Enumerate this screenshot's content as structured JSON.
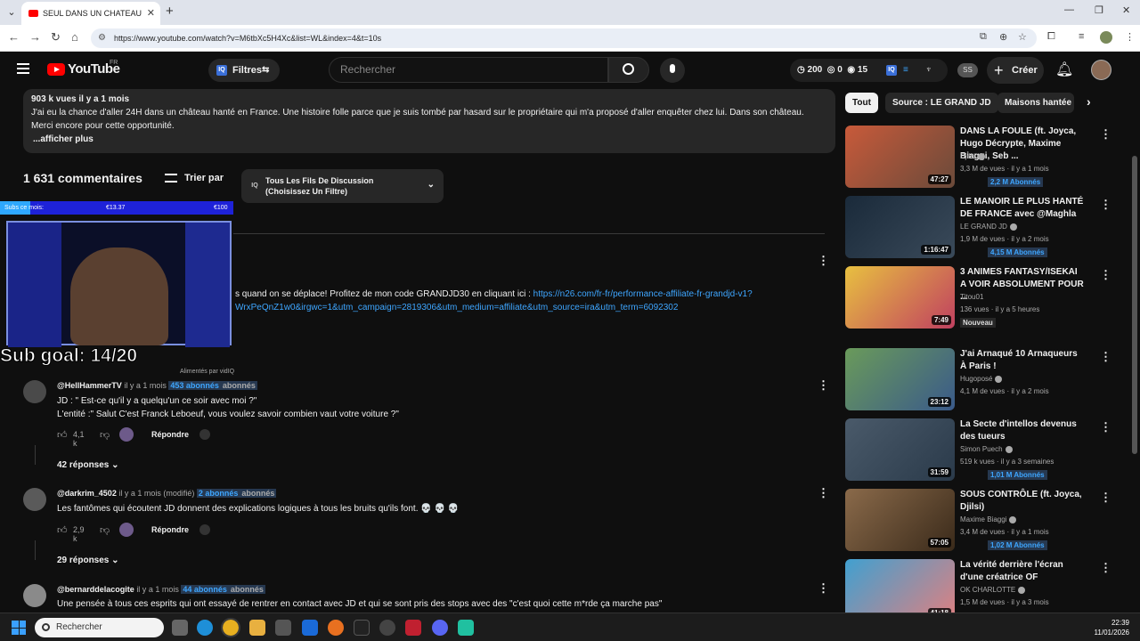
{
  "browser": {
    "tab_title": "SEUL DANS UN CHATEAU HANTÉ",
    "url": "https://www.youtube.com/watch?v=M6tbXc5H4Xc&list=WL&index=4&t=10s"
  },
  "youtube": {
    "logo_text": "YouTube",
    "region": "FR",
    "filters_label": "Filtres",
    "search_placeholder": "Rechercher",
    "stats": {
      "views": "200",
      "likes": "0",
      "watch": "15"
    },
    "ss_label": "SS",
    "create_label": "Créer"
  },
  "description": {
    "meta": "903 k vues  il y a 1 mois",
    "text": "J'ai eu la chance d'aller 24H dans un château hanté en France. Une histoire folle parce que je suis tombé par hasard sur le propriétaire qui m'a proposé d'aller enquêter chez lui. Dans son château. Merci encore pour cette opportunité.",
    "more": "...afficher plus"
  },
  "comments_header": {
    "count": "1 631 commentaires",
    "sort_label": "Trier par",
    "thread_filter": "Tous Les Fils De Discussion (Choisissez Un Filtre)"
  },
  "pinned": {
    "text": "s quand on se déplace! Profitez de mon code GRANDJD30 en cliquant ici : ",
    "link": "https://n26.com/fr-fr/performance-affiliate-fr-grandjd-v1?WrxPeQnZ1w0&irgwc=1&utm_campaign=2819306&utm_medium=affiliate&utm_source=ira&utm_term=6092302"
  },
  "stream_overlay": {
    "bar_label": "Subs ce mois:",
    "bar_mid": "€13.37",
    "bar_right": "€100",
    "sub_goal": "Sub goal: 14/20",
    "vidiq_credit": "Alimentés par vidIQ"
  },
  "comments": [
    {
      "author": "@HellHammerTV",
      "time": "il y a 1 mois",
      "subs": "453 abonnés",
      "subs_suffix": "abonnés",
      "lines": [
        "JD : \" Est-ce qu'il y a quelqu'un ce soir avec moi ?\"",
        "L'entité :\" Salut C'est Franck Leboeuf, vous voulez savoir combien vaut votre voiture ?\""
      ],
      "likes": "4,1 k",
      "reply_label": "Répondre",
      "replies": "42 réponses"
    },
    {
      "author": "@darkrim_4502",
      "time": "il y a 1 mois (modifié)",
      "subs": "2 abonnés",
      "subs_suffix": "abonnés",
      "lines": [
        "Les fantômes qui écoutent JD donnent des explications logiques à tous les bruits qu'ils font. 💀 💀 💀"
      ],
      "likes": "2,9 k",
      "reply_label": "Répondre",
      "replies": "29 réponses"
    },
    {
      "author": "@bernarddelacogite",
      "time": "il y a 1 mois",
      "subs": "44 abonnés",
      "subs_suffix": "abonnés",
      "lines": [
        "Une pensée à tous ces esprits qui ont essayé de rentrer en contact avec JD et qui se sont pris des stops avec des \"c'est quoi cette m*rde ça marche pas\""
      ]
    }
  ],
  "chips": [
    "Tout",
    "Source : LE GRAND JD",
    "Maisons hantée"
  ],
  "videos": [
    {
      "title": "DANS LA FOULE (ft. Joyca, Hugo Décrypte, Maxime Biaggi, Seb ...",
      "channel": "Djilsi",
      "meta": "3,3 M de vues · il y a 1 mois",
      "badge": "2,2 M Abonnés",
      "duration": "47:27",
      "colors": [
        "#c85a3a",
        "#6a4a3a"
      ]
    },
    {
      "title": "LE MANOIR LE PLUS HANTÉ DE FRANCE avec @Maghla",
      "channel": "LE GRAND JD",
      "meta": "1,9 M de vues · il y a 2 mois",
      "badge": "4,15 M Abonnés",
      "duration": "1:16:47",
      "colors": [
        "#1a2a3a",
        "#3a4a5a"
      ]
    },
    {
      "title": "3 ANIMES FANTASY/ISEKAI A VOIR ABSOLUMENT POUR ...",
      "channel": "Titou01",
      "meta": "136 vues · il y a 5 heures",
      "badge": "Nouveau",
      "duration": "7:49",
      "colors": [
        "#e8c040",
        "#c04060"
      ]
    },
    {
      "title": "J'ai Arnaqué 10 Arnaqueurs À Paris !",
      "channel": "Hugoposé",
      "meta": "4,1 M de vues · il y a 2 mois",
      "badge": "",
      "duration": "23:12",
      "colors": [
        "#6a9a5a",
        "#3a5a8a"
      ]
    },
    {
      "title": "La Secte d'intellos devenus des tueurs",
      "channel": "Simon Puech",
      "meta": "519 k vues · il y a 3 semaines",
      "badge": "1,01 M Abonnés",
      "duration": "31:59",
      "colors": [
        "#4a5a6a",
        "#2a3a4a"
      ]
    },
    {
      "title": "SOUS CONTRÔLE (ft. Joyca, Djilsi)",
      "channel": "Maxime Biaggi",
      "meta": "3,4 M de vues · il y a 1 mois",
      "badge": "1,02 M Abonnés",
      "duration": "57:05",
      "colors": [
        "#8a6a4a",
        "#3a2a1a"
      ]
    },
    {
      "title": "La vérité derrière l'écran d'une créatrice OF",
      "channel": "OK CHARLOTTE",
      "meta": "1,5 M de vues · il y a 3 mois",
      "badge": "",
      "duration": "41:18",
      "colors": [
        "#40a0d0",
        "#e08080"
      ]
    }
  ],
  "taskbar": {
    "search_placeholder": "Rechercher",
    "time": "22:39",
    "date": "11/01/2026"
  }
}
